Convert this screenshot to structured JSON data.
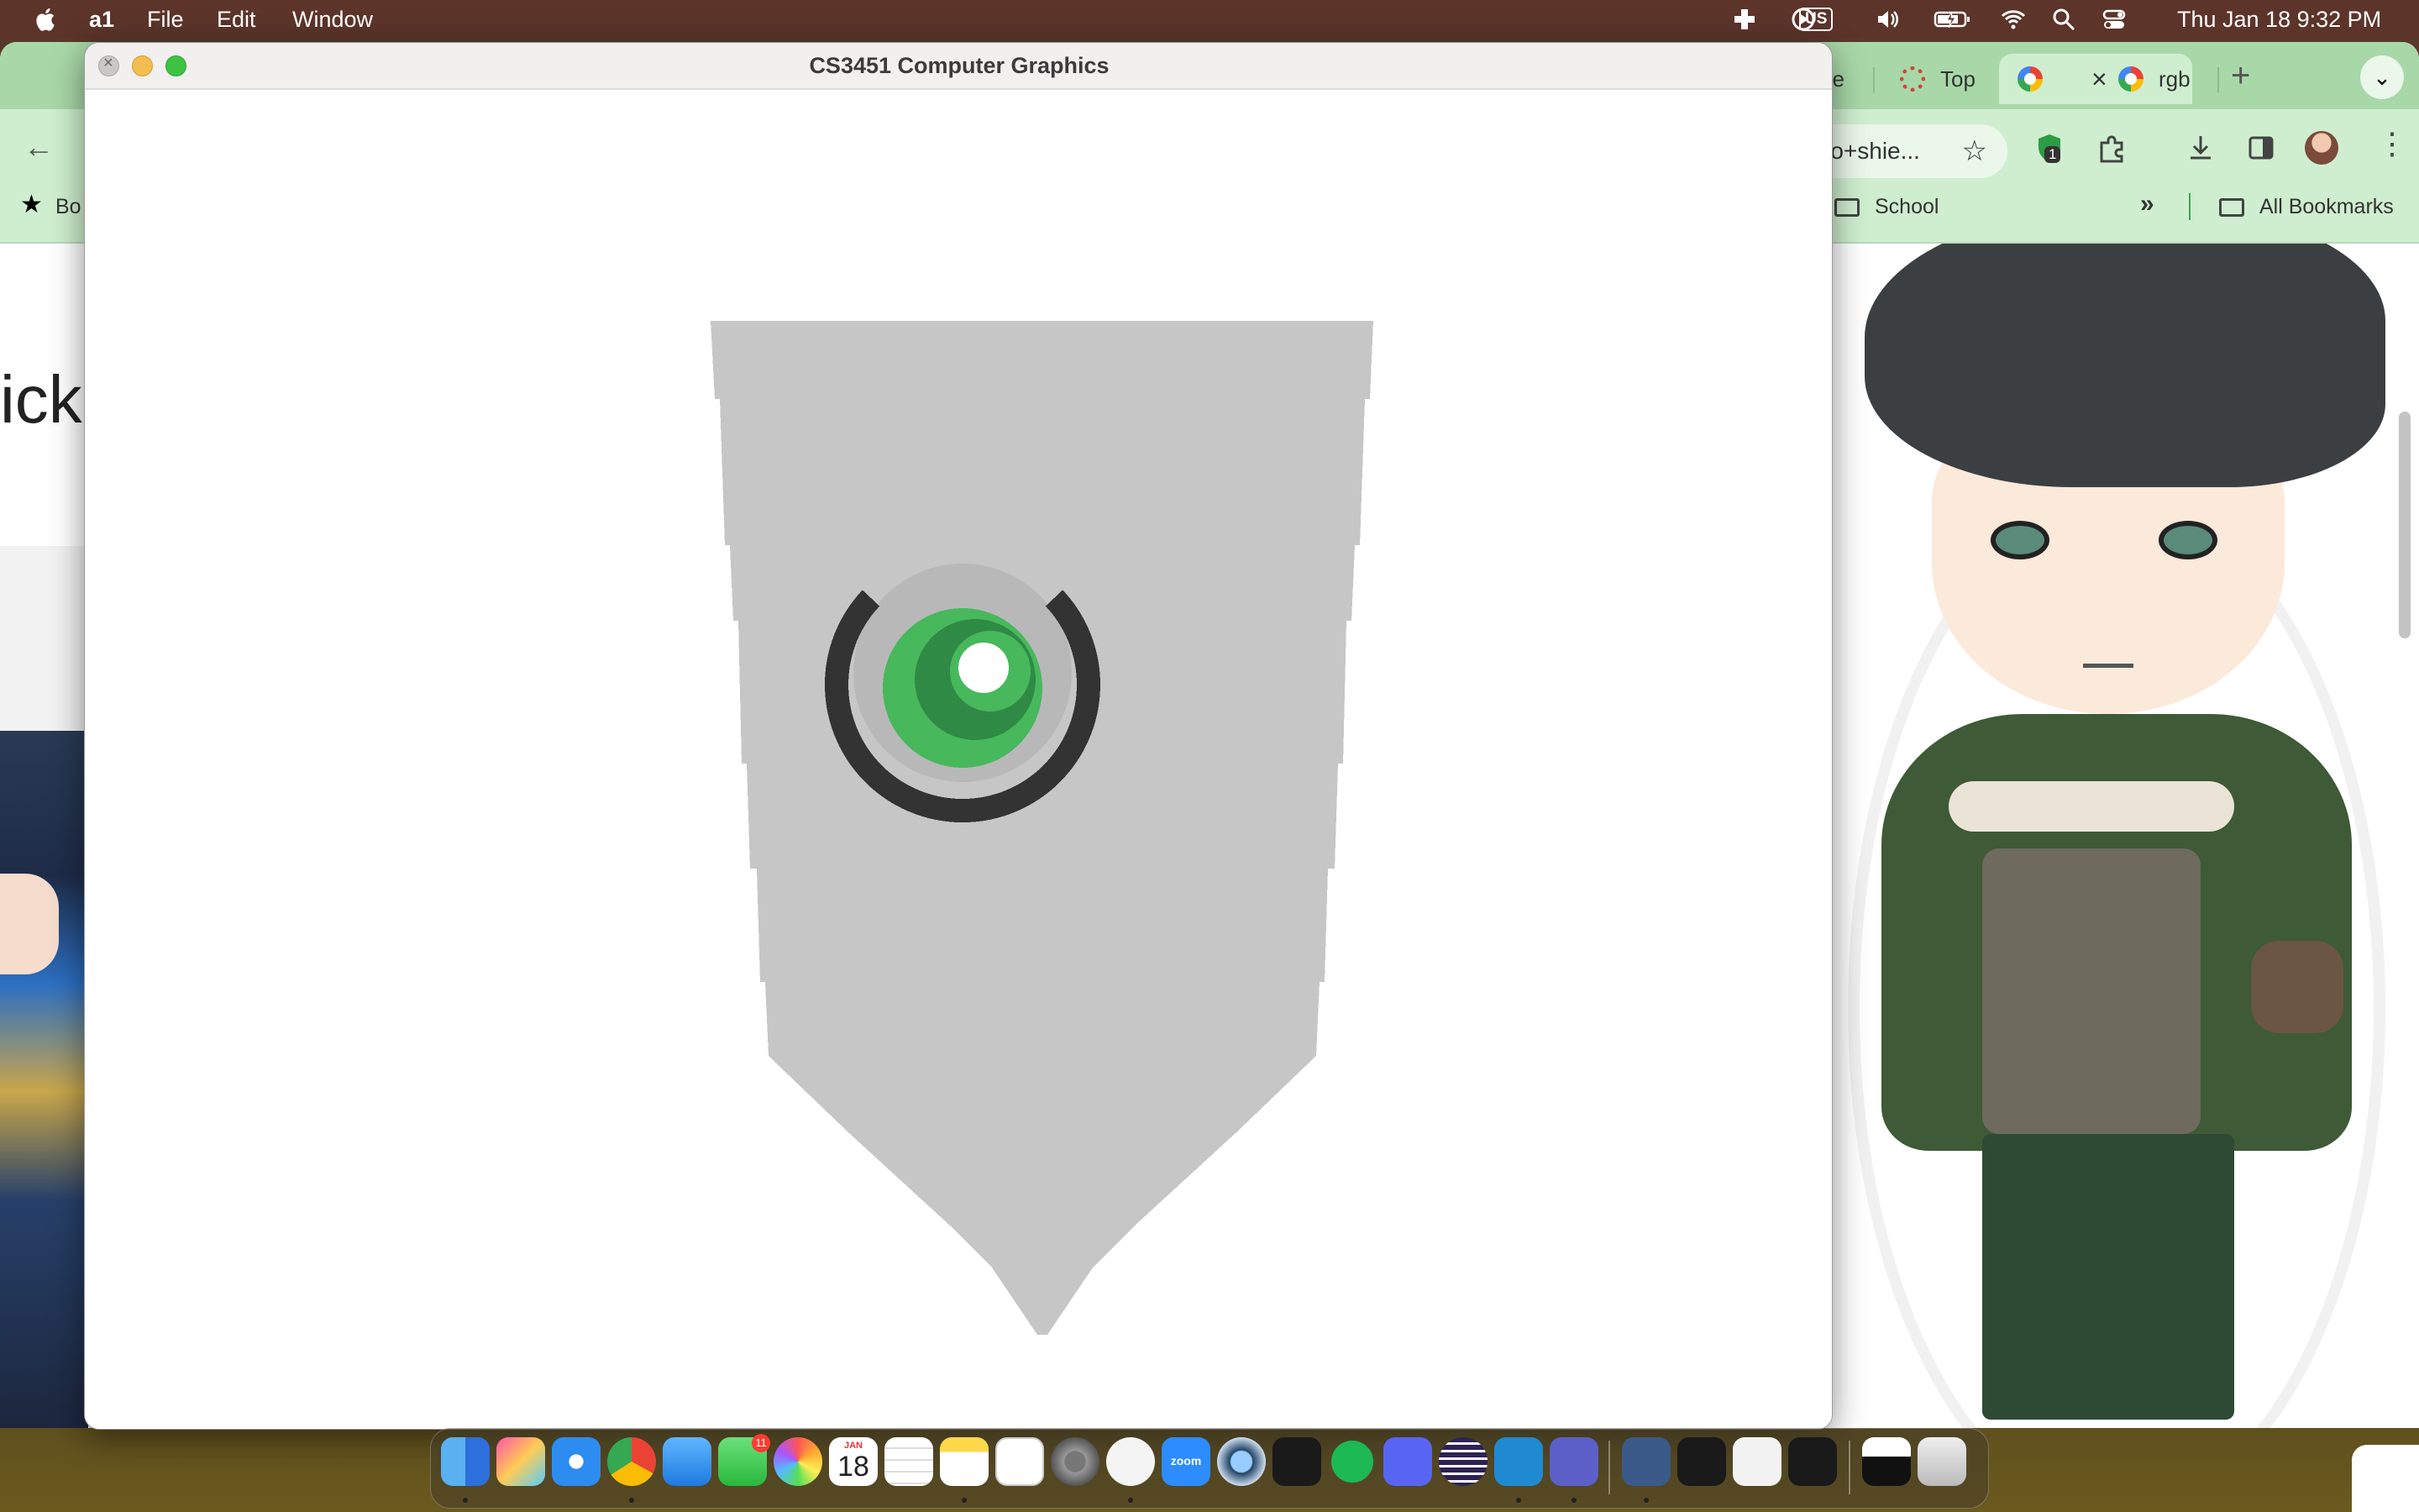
{
  "menubar": {
    "app_name": "a1",
    "menus": [
      "File",
      "Edit",
      "Window"
    ],
    "clock": "Thu Jan 18  9:32 PM",
    "input_source": "US"
  },
  "browser": {
    "tabs": [
      {
        "label": "ile",
        "active": false
      },
      {
        "label": "Top",
        "active": false
      },
      {
        "label": "",
        "active": true
      },
      {
        "label": "rgb",
        "active": false
      }
    ],
    "omnibox_text": "ro+shie...",
    "extension_badge": "1",
    "bookmarks": {
      "left_label": "Bo",
      "school": "School",
      "all": "All Bookmarks"
    },
    "partial_heading": "ick"
  },
  "app_window": {
    "title": "CS3451 Computer Graphics"
  },
  "scene": {
    "shield_color": "#c6c6c6",
    "ring_color": "#333333",
    "gem_outer": "#47b85c",
    "gem_inner": "#2f8a45",
    "highlight": "#ffffff"
  },
  "dock": {
    "calendar_month": "JAN",
    "calendar_day": "18",
    "messages_badge": "11",
    "zoom_label": "zoom"
  }
}
